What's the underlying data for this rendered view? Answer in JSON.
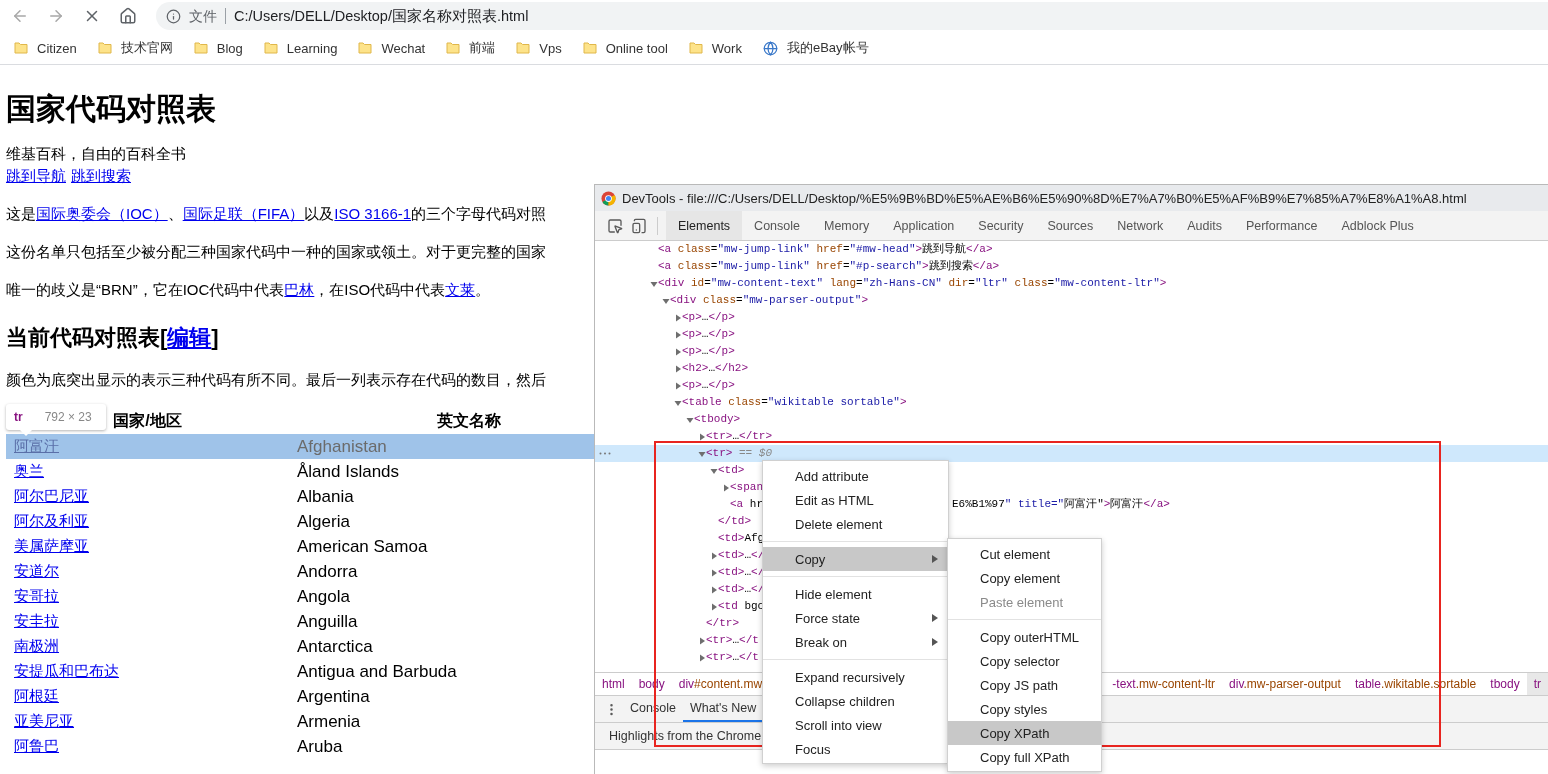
{
  "browser": {
    "address": {
      "scheme": "文件",
      "url": "C:/Users/DELL/Desktop/国家名称对照表.html"
    },
    "bookmarks": [
      {
        "label": "Citizen",
        "kind": "folder"
      },
      {
        "label": "技术官网",
        "kind": "folder"
      },
      {
        "label": "Blog",
        "kind": "folder"
      },
      {
        "label": "Learning",
        "kind": "folder"
      },
      {
        "label": "Wechat",
        "kind": "folder"
      },
      {
        "label": "前端",
        "kind": "folder"
      },
      {
        "label": "Vps",
        "kind": "folder"
      },
      {
        "label": "Online tool",
        "kind": "folder"
      },
      {
        "label": "Work",
        "kind": "folder"
      },
      {
        "label": "我的eBay帐号",
        "kind": "page"
      }
    ]
  },
  "page": {
    "title": "国家代码对照表",
    "tagline": "维基百科，自由的百科全书",
    "jump_links": [
      "跳到导航",
      "跳到搜索"
    ],
    "paragraphs": [
      [
        {
          "text": "这是"
        },
        {
          "text": "国际奥委会（IOC）",
          "link": true
        },
        {
          "text": "、"
        },
        {
          "text": "国际足联（FIFA）",
          "link": true
        },
        {
          "text": "以及"
        },
        {
          "text": "ISO 3166-1",
          "link": true
        },
        {
          "text": "的三个字母代码对照"
        }
      ],
      [
        {
          "text": "这份名单只包括至少被分配三种国家代码中一种的国家或领土。对于更完整的国家"
        }
      ],
      [
        {
          "text": "唯一的歧义是“BRN”，它在IOC代码中代表"
        },
        {
          "text": "巴林",
          "link": true
        },
        {
          "text": "，在ISO代码中代表"
        },
        {
          "text": "文莱",
          "link": true
        },
        {
          "text": "。"
        }
      ]
    ],
    "section": {
      "title": "当前代码对照表",
      "open": "[",
      "edit": "编辑",
      "close": "]"
    },
    "section_note": "颜色为底突出显示的表示三种代码有所不同。最后一列表示存在代码的数目，然后",
    "table": {
      "columns": [
        "国家/地区",
        "英文名称"
      ],
      "rows": [
        {
          "name": "阿富汗",
          "english": "Afghanistan",
          "selected": true
        },
        {
          "name": "奥兰",
          "english": "Åland Islands",
          "selected": false
        },
        {
          "name": "阿尔巴尼亚",
          "english": "Albania",
          "selected": false
        },
        {
          "name": "阿尔及利亚",
          "english": "Algeria",
          "selected": false
        },
        {
          "name": "美属萨摩亚",
          "english": "American Samoa",
          "selected": false
        },
        {
          "name": "安道尔",
          "english": "Andorra",
          "selected": false
        },
        {
          "name": "安哥拉",
          "english": "Angola",
          "selected": false
        },
        {
          "name": "安圭拉",
          "english": "Anguilla",
          "selected": false
        },
        {
          "name": "南极洲",
          "english": "Antarctica",
          "selected": false
        },
        {
          "name": "安提瓜和巴布达",
          "english": "Antigua and Barbuda",
          "selected": false
        },
        {
          "name": "阿根廷",
          "english": "Argentina",
          "selected": false
        },
        {
          "name": "亚美尼亚",
          "english": "Armenia",
          "selected": false
        },
        {
          "name": "阿鲁巴",
          "english": "Aruba",
          "selected": false
        }
      ]
    },
    "inspect_tooltip": {
      "tag": "tr",
      "size": "792 × 23"
    }
  },
  "devtools": {
    "title": "DevTools - file:///C:/Users/DELL/Desktop/%E5%9B%BD%E5%AE%B6%E5%90%8D%E7%A7%B0%E5%AF%B9%E7%85%A7%E8%A1%A8.html",
    "tabs": [
      {
        "label": "Elements",
        "selected": true
      },
      {
        "label": "Console",
        "selected": false
      },
      {
        "label": "Memory",
        "selected": false
      },
      {
        "label": "Application",
        "selected": false
      },
      {
        "label": "Security",
        "selected": false
      },
      {
        "label": "Sources",
        "selected": false
      },
      {
        "label": "Network",
        "selected": false
      },
      {
        "label": "Audits",
        "selected": false
      },
      {
        "label": "Performance",
        "selected": false
      },
      {
        "label": "Adblock Plus",
        "selected": false
      }
    ],
    "tree": [
      {
        "kind": "text",
        "text": "<a class=\"mw-jump-link\" href=\"#mw-head\">跳到导航</a>",
        "selected": false
      },
      {
        "kind": "text",
        "text": "<a class=\"mw-jump-link\" href=\"#p-search\">跳到搜索</a>",
        "selected": false
      },
      {
        "kind": "element",
        "text": "<div id=\"mw-content-text\" lang=\"zh-Hans-CN\" dir=\"ltr\" class=\"mw-content-ltr\">",
        "expanded": true,
        "selected": false,
        "children": [
          {
            "kind": "element",
            "text": "<div class=\"mw-parser-output\">",
            "expanded": true,
            "selected": false,
            "children": [
              {
                "kind": "element",
                "text": "<p>…</p>",
                "expanded": false,
                "selected": false
              },
              {
                "kind": "element",
                "text": "<p>…</p>",
                "expanded": false,
                "selected": false
              },
              {
                "kind": "element",
                "text": "<p>…</p>",
                "expanded": false,
                "selected": false
              },
              {
                "kind": "element",
                "text": "<h2>…</h2>",
                "expanded": false,
                "selected": false
              },
              {
                "kind": "element",
                "text": "<p>…</p>",
                "expanded": false,
                "selected": false
              },
              {
                "kind": "element",
                "text": "<table class=\"wikitable sortable\">",
                "expanded": true,
                "selected": false,
                "children": [
                  {
                    "kind": "element",
                    "text": "<tbody>",
                    "expanded": true,
                    "selected": false,
                    "children": [
                      {
                        "kind": "element",
                        "text": "<tr>…</tr>",
                        "expanded": false,
                        "selected": false
                      },
                      {
                        "kind": "element",
                        "text": "<tr>",
                        "marker": "== $0",
                        "expanded": true,
                        "selected": true,
                        "close": "</tr>",
                        "children": [
                          {
                            "kind": "element",
                            "text": "<td>",
                            "expanded": true,
                            "selected": false,
                            "close": "</td>",
                            "children": [
                              {
                                "kind": "element",
                                "text": "<span",
                                "expanded": false,
                                "selected": false
                              },
                              {
                                "kind": "text",
                                "text": "<a hr",
                                "tail": "E6%B1%97\" title=\"阿富汗\">阿富汗</a>",
                                "selected": false
                              }
                            ]
                          },
                          {
                            "kind": "text",
                            "text": "<td>Afg",
                            "selected": false
                          },
                          {
                            "kind": "element",
                            "text": "<td>…</",
                            "expanded": false,
                            "selected": false
                          },
                          {
                            "kind": "element",
                            "text": "<td>…</",
                            "expanded": false,
                            "selected": false
                          },
                          {
                            "kind": "element",
                            "text": "<td>…</",
                            "expanded": false,
                            "selected": false
                          },
                          {
                            "kind": "element",
                            "text": "<td bgc",
                            "expanded": false,
                            "selected": false
                          }
                        ]
                      },
                      {
                        "kind": "element",
                        "text": "<tr>…</t",
                        "expanded": false,
                        "selected": false
                      },
                      {
                        "kind": "element",
                        "text": "<tr>…</t",
                        "expanded": false,
                        "selected": false
                      }
                    ]
                  }
                ]
              }
            ]
          }
        ]
      }
    ],
    "breadcrumbs": {
      "left": [
        {
          "label": "html",
          "selected": false
        },
        {
          "label": "body",
          "selected": false
        },
        {
          "label": "div#content.mw",
          "selected": false
        }
      ],
      "right": [
        {
          "label": "-text.mw-content-ltr",
          "selected": false
        },
        {
          "label": "div.mw-parser-output",
          "selected": false
        },
        {
          "label": "table.wikitable.sortable",
          "selected": false
        },
        {
          "label": "tbody",
          "selected": false
        },
        {
          "label": "tr",
          "selected": true
        }
      ]
    },
    "drawer_tabs": [
      {
        "label": "Console",
        "selected": false
      },
      {
        "label": "What's New",
        "selected": true
      }
    ],
    "drawer_text": "Highlights from the Chrome"
  },
  "context_menu": [
    {
      "kind": "item",
      "label": "Add attribute",
      "selected": false,
      "submenu": false
    },
    {
      "kind": "item",
      "label": "Edit as HTML",
      "selected": false,
      "submenu": false
    },
    {
      "kind": "item",
      "label": "Delete element",
      "selected": false,
      "submenu": false
    },
    {
      "kind": "separator"
    },
    {
      "kind": "item",
      "label": "Copy",
      "selected": true,
      "submenu": true
    },
    {
      "kind": "separator"
    },
    {
      "kind": "item",
      "label": "Hide element",
      "selected": false,
      "submenu": false
    },
    {
      "kind": "item",
      "label": "Force state",
      "selected": false,
      "submenu": true
    },
    {
      "kind": "item",
      "label": "Break on",
      "selected": false,
      "submenu": true
    },
    {
      "kind": "separator"
    },
    {
      "kind": "item",
      "label": "Expand recursively",
      "selected": false,
      "submenu": false
    },
    {
      "kind": "item",
      "label": "Collapse children",
      "selected": false,
      "submenu": false
    },
    {
      "kind": "item",
      "label": "Scroll into view",
      "selected": false,
      "submenu": false
    },
    {
      "kind": "item",
      "label": "Focus",
      "selected": false,
      "submenu": false
    }
  ],
  "copy_submenu": [
    {
      "kind": "item",
      "label": "Cut element",
      "selected": false,
      "disabled": false
    },
    {
      "kind": "item",
      "label": "Copy element",
      "selected": false,
      "disabled": false
    },
    {
      "kind": "item",
      "label": "Paste element",
      "selected": false,
      "disabled": true
    },
    {
      "kind": "separator"
    },
    {
      "kind": "item",
      "label": "Copy outerHTML",
      "selected": false,
      "disabled": false
    },
    {
      "kind": "item",
      "label": "Copy selector",
      "selected": false,
      "disabled": false
    },
    {
      "kind": "item",
      "label": "Copy JS path",
      "selected": false,
      "disabled": false
    },
    {
      "kind": "item",
      "label": "Copy styles",
      "selected": false,
      "disabled": false
    },
    {
      "kind": "item",
      "label": "Copy XPath",
      "selected": true,
      "disabled": false
    },
    {
      "kind": "item",
      "label": "Copy full XPath",
      "selected": false,
      "disabled": false
    }
  ]
}
